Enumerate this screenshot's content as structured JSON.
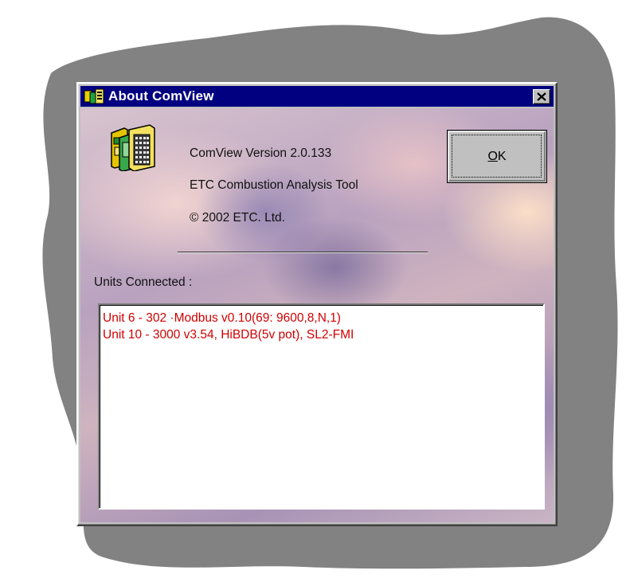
{
  "window": {
    "title": "About ComView",
    "close_glyph": "✕"
  },
  "about": {
    "app_icon": "stacked-documents-icon",
    "version_line": "ComView  Version 2.0.133",
    "product_line": "ETC Combustion Analysis Tool",
    "copyright_line": "© 2002 ETC. Ltd."
  },
  "buttons": {
    "ok_label": "OK",
    "ok_mnemonic": "O",
    "ok_rest": "K"
  },
  "units": {
    "label": "Units Connected :",
    "items": [
      "Unit  6 - 302  ·Modbus v0.10(69:  9600,8,N,1)",
      "Unit  10 - 3000 v3.54, HiBDB(5v pot), SL2-FMI"
    ]
  },
  "colors": {
    "titlebar": "#000080",
    "unit_text": "#d00000",
    "backdrop_shadow": "#808080"
  }
}
